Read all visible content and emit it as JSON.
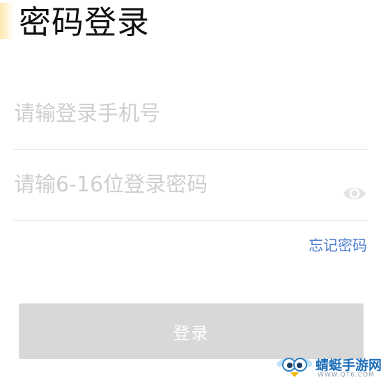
{
  "header": {
    "title": "密码登录"
  },
  "form": {
    "phone": {
      "placeholder": "请输登录手机号",
      "value": ""
    },
    "password": {
      "placeholder": "请输6-16位登录密码",
      "value": "",
      "toggle_icon": "eye-icon"
    },
    "forgot_password_label": "忘记密码",
    "login_button_label": "登录"
  },
  "watermark": {
    "name": "蜻蜓手游网",
    "url": "WWW.QT6.COM",
    "icon": "dragonfly-mascot-icon"
  },
  "colors": {
    "title": "#111111",
    "placeholder": "#cfcfcf",
    "link": "#4f7fcf",
    "button_disabled": "#d8d8d8",
    "divider": "#e6e6e6",
    "accent": "#ffd66e"
  }
}
